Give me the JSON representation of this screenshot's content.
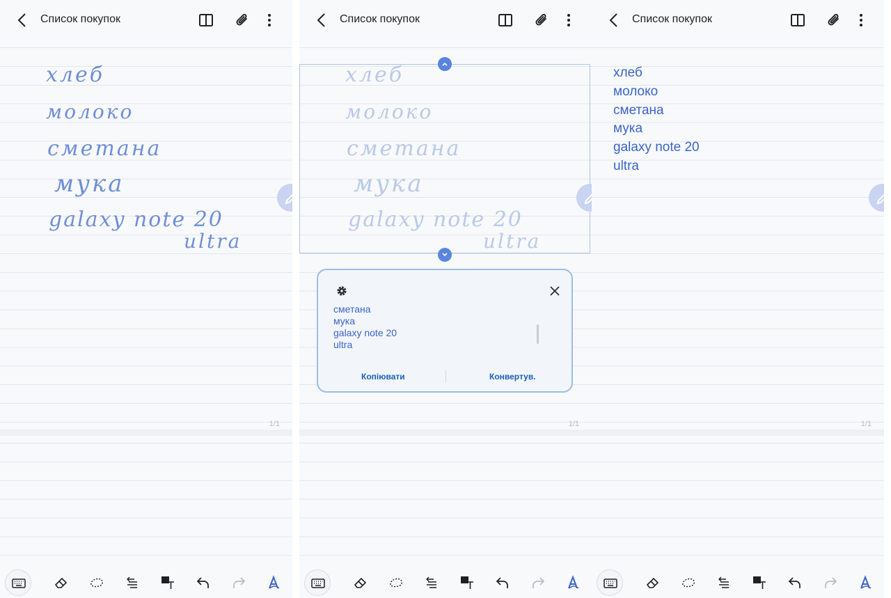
{
  "header": {
    "title": "Список покупок"
  },
  "panels": [
    {
      "id": "handwritten",
      "handwriting": [
        "хлеб",
        "молоко",
        "сметана",
        "мука",
        "galaxy note 20",
        "ultra"
      ],
      "page_indicator": "1/1"
    },
    {
      "id": "recognition",
      "handwriting": [
        "хлеб",
        "молоко",
        "сметана",
        "мука",
        "galaxy note 20",
        "ultra"
      ],
      "popup": {
        "recognized_lines": [
          "сметана",
          "мука",
          "galaxy note 20",
          "ultra"
        ],
        "copy_label": "Копіювати",
        "convert_label": "Конвертув."
      },
      "page_indicator": "1/1"
    },
    {
      "id": "converted",
      "typed_lines": [
        "хлеб",
        "молоко",
        "сметана",
        "мука",
        "galaxy note 20",
        "ultra"
      ],
      "page_indicator": "1/1"
    }
  ],
  "icons": {
    "back": "chevron-left-icon",
    "book": "book-view-icon",
    "attach": "paperclip-icon",
    "more": "more-vert-icon",
    "pen_fab": "pen-icon",
    "toolbar": [
      "keyboard-icon",
      "eraser-icon",
      "lasso-icon",
      "text-align-icon",
      "image-text-icon",
      "undo-icon",
      "redo-icon",
      "handwriting-convert-icon"
    ]
  },
  "colors": {
    "accent": "#3b63c9",
    "ink": "#6f8fd6",
    "selection": "#5a85dc",
    "fab": "#c9d3f2"
  }
}
